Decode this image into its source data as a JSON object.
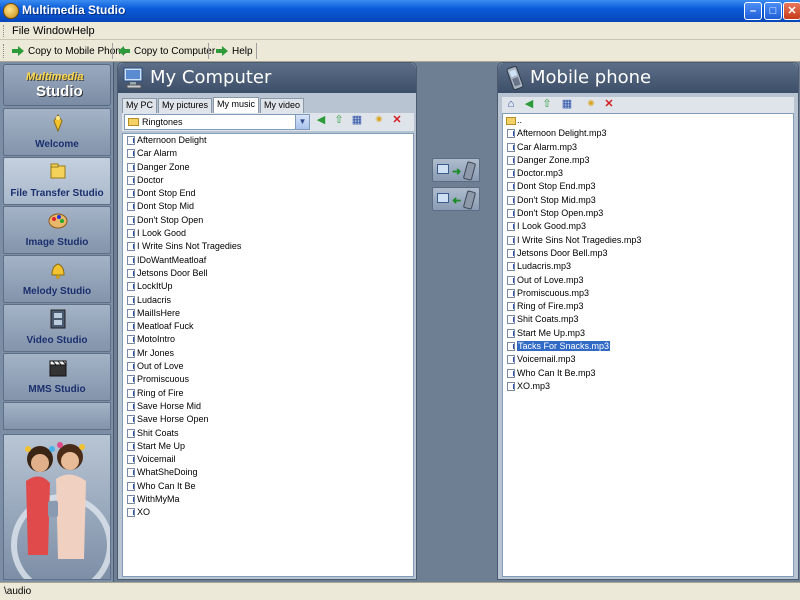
{
  "window": {
    "title": "Multimedia Studio",
    "min": "–",
    "max": "□",
    "close": "✕"
  },
  "menu": [
    "File",
    "Window",
    "Help"
  ],
  "toolbar": {
    "copy_to_mobile": "Copy to Mobile Phone",
    "copy_to_computer": "Copy to Computer",
    "help": "Help"
  },
  "sidebar": {
    "logo_line1": "Multimedia",
    "logo_line2": "Studio",
    "items": [
      {
        "label": "Welcome",
        "icon": "welcome-icon"
      },
      {
        "label": "File Transfer Studio",
        "icon": "file-transfer-icon"
      },
      {
        "label": "Image Studio",
        "icon": "image-palette-icon"
      },
      {
        "label": "Melody Studio",
        "icon": "bell-icon"
      },
      {
        "label": "Video Studio",
        "icon": "film-icon"
      },
      {
        "label": "MMS Studio",
        "icon": "clapper-icon"
      }
    ],
    "active_index": 1
  },
  "left_panel": {
    "title": "My Computer",
    "tabs": [
      "My PC",
      "My pictures",
      "My music",
      "My video"
    ],
    "active_tab": 2,
    "folder": "Ringtones",
    "files": [
      "Afternoon Delight",
      "Car Alarm",
      "Danger Zone",
      "Doctor",
      "Dont Stop End",
      "Dont Stop Mid",
      "Don't Stop Open",
      "I Look Good",
      "I Write Sins Not Tragedies",
      "IDoWantMeatloaf",
      "Jetsons Door Bell",
      "LockItUp",
      "Ludacris",
      "MailIsHere",
      "Meatloaf Fuck",
      "MotoIntro",
      "Mr Jones",
      "Out of Love",
      "Promiscuous",
      "Ring of Fire",
      "Save Horse Mid",
      "Save Horse Open",
      "Shit Coats",
      "Start Me Up",
      "Voicemail",
      "WhatSheDoing",
      "Who Can It Be",
      "WithMyMa",
      "XO"
    ]
  },
  "right_panel": {
    "title": "Mobile phone",
    "parent_folder": "..",
    "files": [
      "Afternoon Delight.mp3",
      "Car Alarm.mp3",
      "Danger Zone.mp3",
      "Doctor.mp3",
      "Dont Stop End.mp3",
      "Don't Stop Mid.mp3",
      "Don't Stop Open.mp3",
      "I Look Good.mp3",
      "I Write Sins Not Tragedies.mp3",
      "Jetsons Door Bell.mp3",
      "Ludacris.mp3",
      "Out of Love.mp3",
      "Promiscuous.mp3",
      "Ring of Fire.mp3",
      "Shit Coats.mp3",
      "Start Me Up.mp3",
      "Tacks For Snacks.mp3",
      "Voicemail.mp3",
      "Who Can It Be.mp3",
      "XO.mp3"
    ],
    "selected_index": 16
  },
  "status": {
    "path": "\\audio"
  },
  "colors": {
    "titlebar": "#0a5bd9",
    "selection": "#316ac5",
    "sidebar": "#7c8ea5",
    "panel_header": "#3d4e68"
  }
}
